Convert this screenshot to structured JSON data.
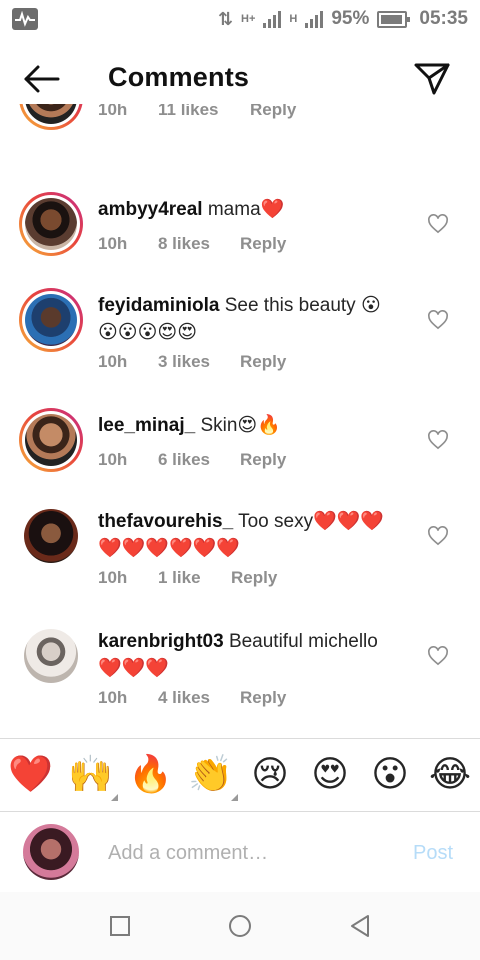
{
  "status_bar": {
    "battery": "95%",
    "time": "05:35",
    "net1": "H+",
    "net2": "H"
  },
  "header": {
    "title": "Comments"
  },
  "comments": [
    {
      "username": "",
      "text": "",
      "time": "10h",
      "likes": "11 likes",
      "reply": "Reply"
    },
    {
      "username": "ambyy4real",
      "text": "mama❤️",
      "time": "10h",
      "likes": "8 likes",
      "reply": "Reply"
    },
    {
      "username": "feyidaminiola",
      "text": "See this beauty 😮",
      "text2": "😮😮😮😍😍",
      "time": "10h",
      "likes": "3 likes",
      "reply": "Reply"
    },
    {
      "username": "lee_minaj_",
      "text": "Skin😍🔥",
      "time": "10h",
      "likes": "6 likes",
      "reply": "Reply"
    },
    {
      "username": "thefavourehis_",
      "text": "Too sexy❤️❤️❤️",
      "text2": "❤️❤️❤️❤️❤️❤️",
      "time": "10h",
      "likes": "1 like",
      "reply": "Reply"
    },
    {
      "username": "karenbright03",
      "text": "Beautiful michello",
      "text2": "❤️❤️❤️",
      "time": "10h",
      "likes": "4 likes",
      "reply": "Reply"
    }
  ],
  "emoji_bar": [
    "❤️",
    "🙌",
    "🔥",
    "👏",
    "😢",
    "😍",
    "😮",
    "😂"
  ],
  "composer": {
    "placeholder": "Add a comment…",
    "post_label": "Post"
  },
  "colors": {
    "accent": "#0095f6",
    "post_disabled": "#b6dcf8",
    "meta": "#8e8e8e"
  }
}
